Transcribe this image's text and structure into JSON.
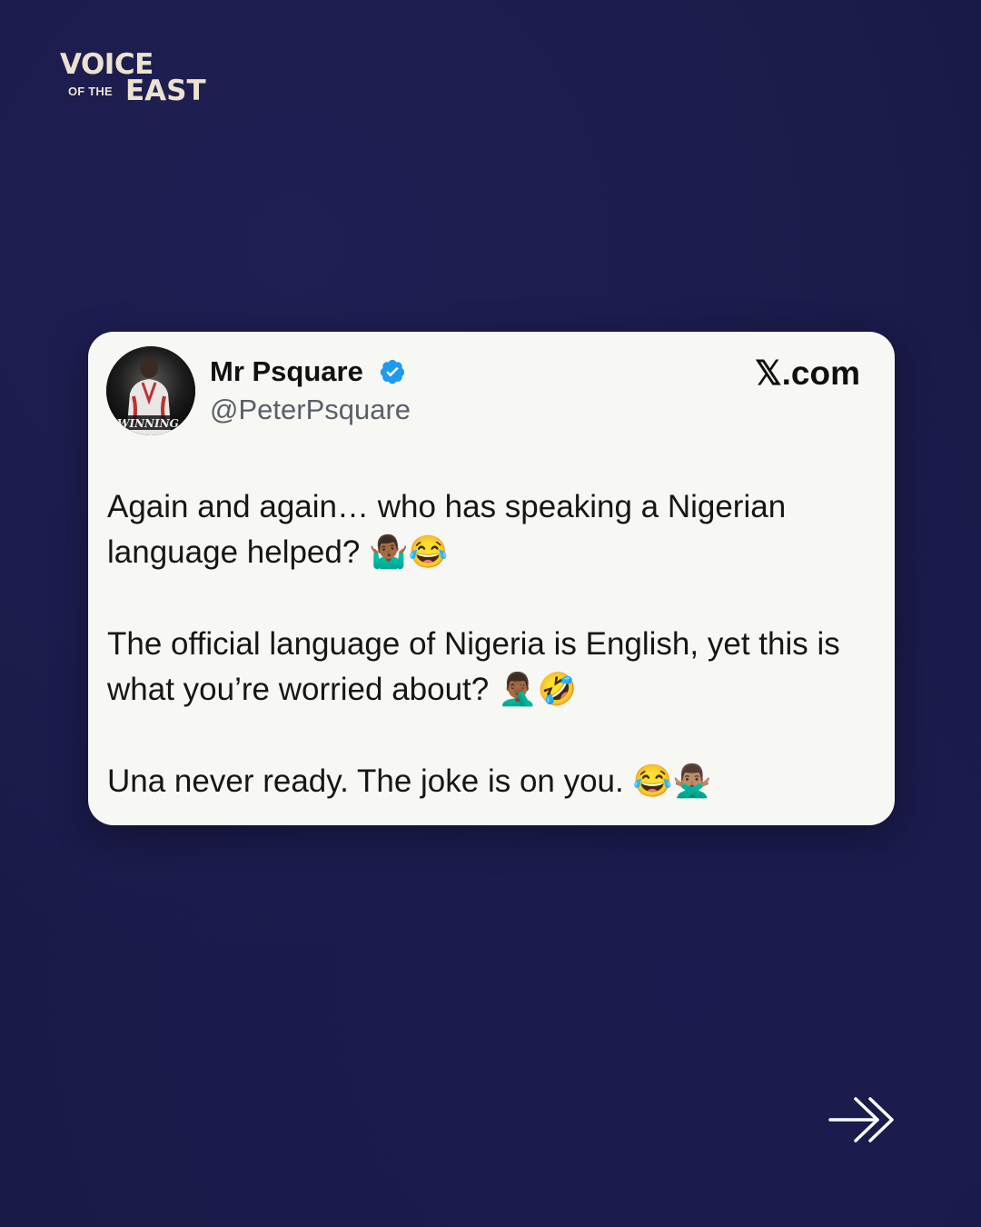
{
  "brand": {
    "line1": "VOICE",
    "line2_small": "OF THE",
    "line2_big": "EAST",
    "color": "#ece3cf"
  },
  "post": {
    "author_name": "Mr Psquare",
    "handle": "@PeterPsquare",
    "verified": true,
    "avatar_text": "WINNING",
    "site": "𝕏.com",
    "paragraphs": [
      "Again and again… who has speaking a Nigerian language helped? 🤷🏾‍♂️😂",
      "The official language of Nigeria is English, yet this is what you’re worried about? 🤦🏾‍♂️🤣",
      "Una never ready. The joke is on you. 😂🙅🏽‍♂️"
    ]
  },
  "navigation": {
    "next_icon": "double-chevron-right-arrow-icon"
  },
  "colors": {
    "background": "#1a1a4a",
    "card": "#f7f7f4",
    "verified_badge": "#1d9bf0"
  }
}
